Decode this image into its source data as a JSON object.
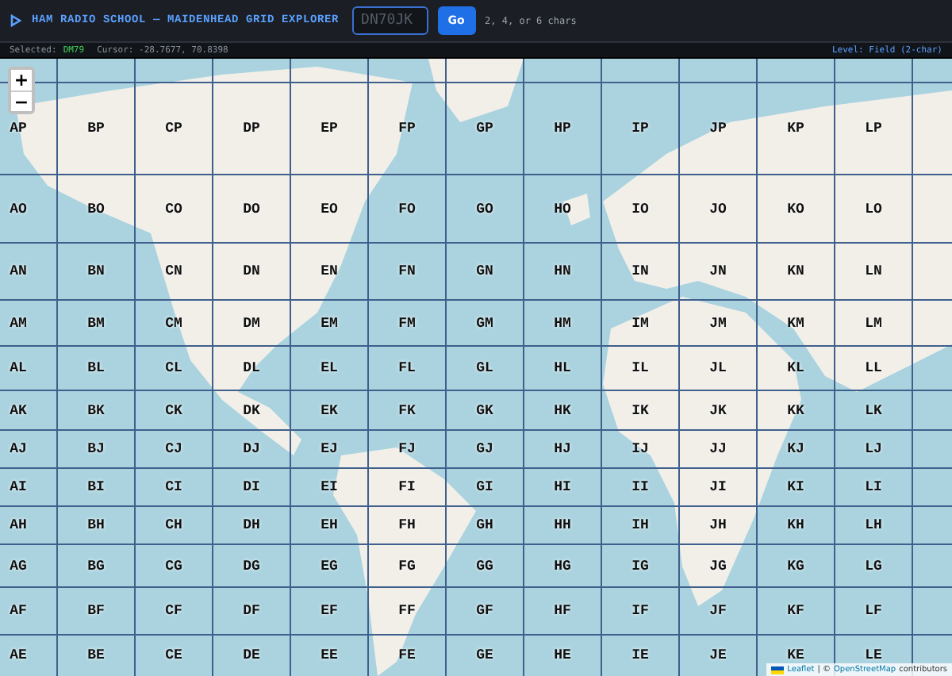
{
  "header": {
    "title": "HAM RADIO SCHOOL — MAIDENHEAD GRID EXPLORER",
    "search": {
      "placeholder": "DN70JK"
    },
    "button": "Go",
    "hint": "2, 4, or 6 chars"
  },
  "status_bar": {
    "selected_label": "Selected:",
    "selected_value": "DM79",
    "cursor": "Cursor: -28.7677, 70.8398",
    "level": "Level: Field (2-char)"
  },
  "map": {
    "zoom_in": "+",
    "zoom_out": "−",
    "grid_rows": [
      [
        "AP",
        "BP",
        "CP",
        "DP",
        "EP",
        "FP",
        "GP",
        "HP",
        "IP",
        "JP",
        "KP",
        "LP"
      ],
      [
        "AO",
        "BO",
        "CO",
        "DO",
        "EO",
        "FO",
        "GO",
        "HO",
        "IO",
        "JO",
        "KO",
        "LO"
      ],
      [
        "AN",
        "BN",
        "CN",
        "DN",
        "EN",
        "FN",
        "GN",
        "HN",
        "IN",
        "JN",
        "KN",
        "LN"
      ],
      [
        "AM",
        "BM",
        "CM",
        "DM",
        "EM",
        "FM",
        "GM",
        "HM",
        "IM",
        "JM",
        "KM",
        "LM"
      ],
      [
        "AL",
        "BL",
        "CL",
        "DL",
        "EL",
        "FL",
        "GL",
        "HL",
        "IL",
        "JL",
        "KL",
        "LL"
      ],
      [
        "AK",
        "BK",
        "CK",
        "DK",
        "EK",
        "FK",
        "GK",
        "HK",
        "IK",
        "JK",
        "KK",
        "LK"
      ],
      [
        "AJ",
        "BJ",
        "CJ",
        "DJ",
        "EJ",
        "FJ",
        "GJ",
        "HJ",
        "IJ",
        "JJ",
        "KJ",
        "LJ"
      ],
      [
        "AI",
        "BI",
        "CI",
        "DI",
        "EI",
        "FI",
        "GI",
        "HI",
        "II",
        "JI",
        "KI",
        "LI"
      ],
      [
        "AH",
        "BH",
        "CH",
        "DH",
        "EH",
        "FH",
        "GH",
        "HH",
        "IH",
        "JH",
        "KH",
        "LH"
      ],
      [
        "AG",
        "BG",
        "CG",
        "DG",
        "EG",
        "FG",
        "GG",
        "HG",
        "IG",
        "JG",
        "KG",
        "LG"
      ],
      [
        "AF",
        "BF",
        "CF",
        "DF",
        "EF",
        "FF",
        "GF",
        "HF",
        "IF",
        "JF",
        "KF",
        "LF"
      ],
      [
        "AE",
        "BE",
        "CE",
        "DE",
        "EE",
        "FE",
        "GE",
        "HE",
        "IE",
        "JE",
        "KE",
        "LE"
      ]
    ],
    "attribution": {
      "leaflet": "Leaflet",
      "separator": "| ©",
      "osm": "OpenStreetMap",
      "suffix": "contributors"
    }
  }
}
